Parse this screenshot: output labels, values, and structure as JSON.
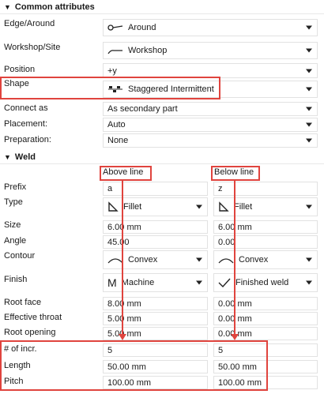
{
  "common": {
    "section_title": "Common attributes",
    "rows": {
      "edge": {
        "label": "Edge/Around",
        "value": "Around"
      },
      "workshop": {
        "label": "Workshop/Site",
        "value": "Workshop"
      },
      "position": {
        "label": "Position",
        "value": "+y"
      },
      "shape": {
        "label": "Shape",
        "value": "Staggered Intermittent"
      },
      "connect": {
        "label": "Connect as",
        "value": "As secondary part"
      },
      "placement": {
        "label": "Placement:",
        "value": "Auto"
      },
      "preparation": {
        "label": "Preparation:",
        "value": "None"
      }
    }
  },
  "weld": {
    "section_title": "Weld",
    "above_header": "Above line",
    "below_header": "Below line",
    "rows": {
      "prefix": {
        "label": "Prefix",
        "above": "a",
        "below": "z"
      },
      "type": {
        "label": "Type",
        "above": "Fillet",
        "below": "Fillet"
      },
      "size": {
        "label": "Size",
        "above": "6.00 mm",
        "below": "6.00 mm"
      },
      "angle": {
        "label": "Angle",
        "above": "45.00",
        "below": "0.00"
      },
      "contour": {
        "label": "Contour",
        "above": "Convex",
        "below": "Convex"
      },
      "finish": {
        "label": "Finish",
        "above": "Machine",
        "below": "Finished weld"
      },
      "root_face": {
        "label": "Root face",
        "above": "8.00 mm",
        "below": "0.00 mm"
      },
      "effective_throat": {
        "label": "Effective throat",
        "above": "5.00 mm",
        "below": "0.00 mm"
      },
      "root_opening": {
        "label": "Root opening",
        "above": "5.00 mm",
        "below": "0.00 mm"
      },
      "incr": {
        "label": "# of incr.",
        "above": "5",
        "below": "5"
      },
      "length": {
        "label": "Length",
        "above": "50.00 mm",
        "below": "50.00 mm"
      },
      "pitch": {
        "label": "Pitch",
        "above": "100.00 mm",
        "below": "100.00 mm"
      }
    }
  },
  "icons": {
    "edge": "around-weld-icon",
    "workshop": "workshop-line-icon",
    "shape": "staggered-intermittent-icon",
    "type": "fillet-triangle-icon",
    "contour": "convex-arc-icon",
    "finish_above": "machine-M-icon",
    "finish_below": "finished-weld-check-icon"
  },
  "colors": {
    "highlight": "#e0443e"
  }
}
